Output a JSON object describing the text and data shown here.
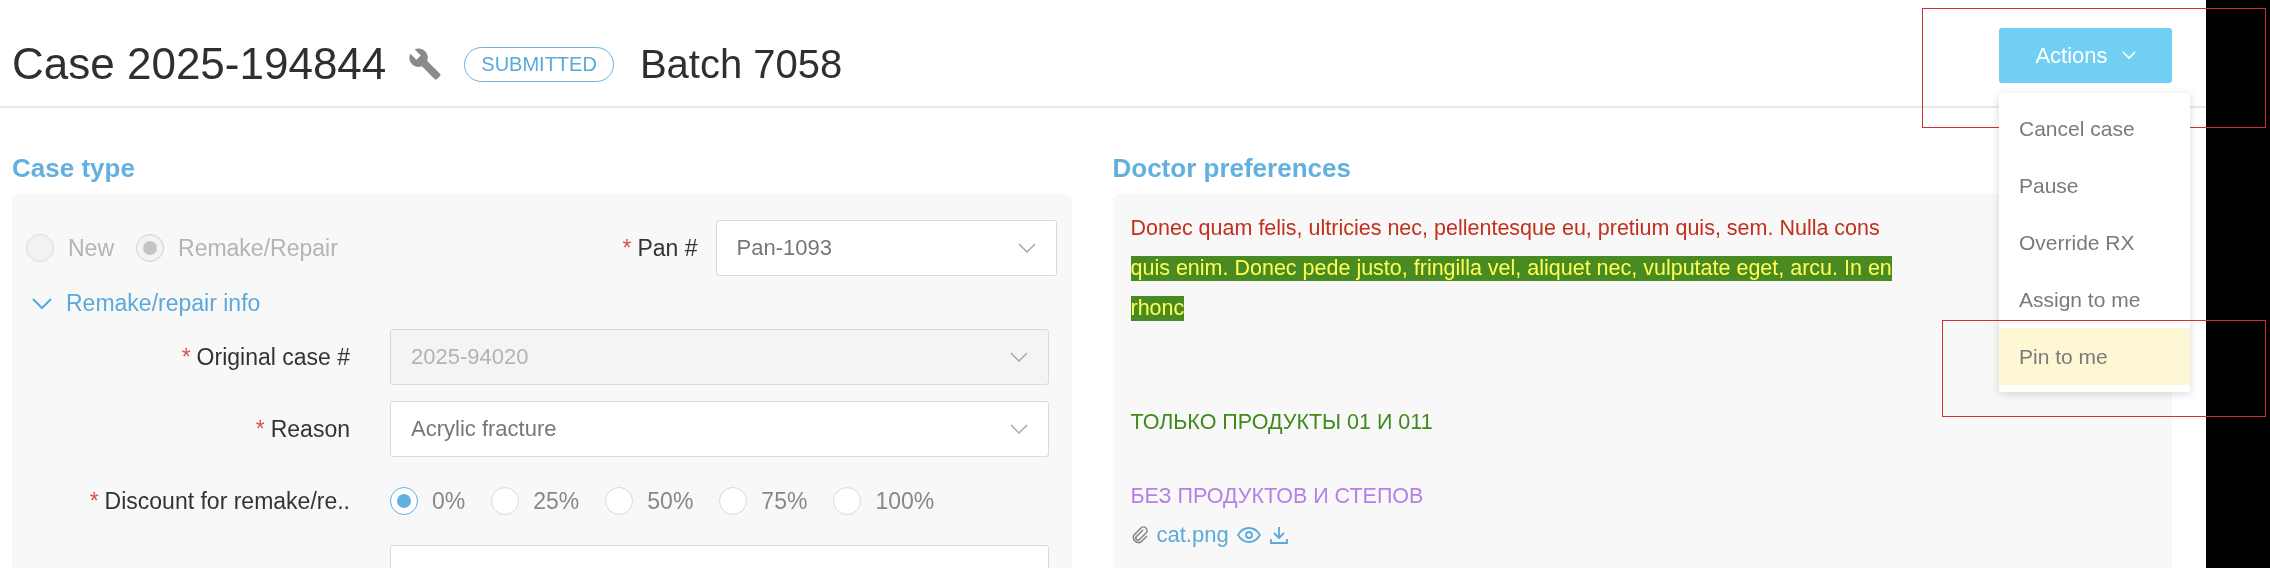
{
  "header": {
    "title": "Case 2025-194844",
    "status": "SUBMITTED",
    "batch": "Batch 7058",
    "actions_button": "Actions",
    "actions_button_framed": true
  },
  "actions_menu": {
    "items": [
      {
        "label": "Cancel case",
        "selected": false,
        "framed": false
      },
      {
        "label": "Pause",
        "selected": false,
        "framed": false
      },
      {
        "label": "Override RX",
        "selected": false,
        "framed": false
      },
      {
        "label": "Assign to me",
        "selected": false,
        "framed": false
      },
      {
        "label": "Pin to me",
        "selected": true,
        "framed": true
      }
    ]
  },
  "case_type": {
    "heading": "Case type",
    "disabled": true,
    "types": [
      {
        "label": "New",
        "selected": false
      },
      {
        "label": "Remake/Repair",
        "selected": true
      }
    ],
    "pan": {
      "label": "Pan #",
      "required_mark": "*",
      "value": "Pan-1093"
    },
    "remake_info": {
      "label": "Remake/repair info",
      "expanded": true,
      "fields": [
        {
          "kind": "select",
          "label": "Original case #",
          "required_mark": "*",
          "value": "2025-94020",
          "disabled": true
        },
        {
          "kind": "select",
          "label": "Reason",
          "required_mark": "*",
          "value": "Acrylic fracture",
          "disabled": false
        },
        {
          "kind": "radio",
          "label": "Discount for remake/re..",
          "required_mark": "*",
          "options": [
            {
              "label": "0%",
              "selected": true
            },
            {
              "label": "25%",
              "selected": false
            },
            {
              "label": "50%",
              "selected": false
            },
            {
              "label": "75%",
              "selected": false
            },
            {
              "label": "100%",
              "selected": false
            }
          ]
        },
        {
          "kind": "select",
          "disabled": false
        }
      ]
    }
  },
  "doctor_preferences": {
    "heading": "Doctor preferences",
    "notes": [
      {
        "kind": "line",
        "color": "#c0301c",
        "text": "Donec quam felis, ultricies nec, pellentesque eu, pretium quis, sem. Nulla cons"
      },
      {
        "kind": "highlight",
        "color": "#4a8a22",
        "text": "quis enim. Donec pede justo, fringilla vel, aliquet nec, vulputate eget, arcu. In en"
      },
      {
        "kind": "highlight",
        "color": "#4a8a22",
        "text": "rhonc"
      },
      {
        "kind": "gap"
      },
      {
        "kind": "paragraph",
        "color": "#3f8a1a",
        "text": "ТОЛЬКО ПРОДУКТЫ 01 И 011"
      },
      {
        "kind": "paragraph",
        "color": "#b77fe8",
        "text": "БЕЗ ПРОДУКТОВ И СТЕПОВ"
      }
    ],
    "attachments": [
      {
        "name": "cat.png"
      }
    ]
  }
}
